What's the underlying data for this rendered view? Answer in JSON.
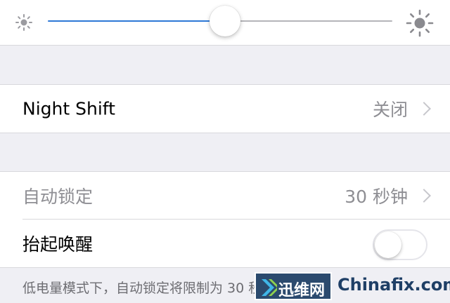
{
  "brightness": {
    "level": 0.5,
    "left_icon": "sun-small-icon",
    "right_icon": "sun-large-icon",
    "accent_color": "#2d78d6"
  },
  "night_shift": {
    "label": "Night Shift",
    "value": "关闭"
  },
  "auto_lock": {
    "label": "自动锁定",
    "value": "30 秒钟"
  },
  "raise_to_wake": {
    "label": "抬起唤醒",
    "enabled": false
  },
  "footer_note": "低电量模式下，自动锁定将限制为 30 秒",
  "watermark": {
    "cn": "迅维网",
    "en": "Chinafix.com"
  }
}
